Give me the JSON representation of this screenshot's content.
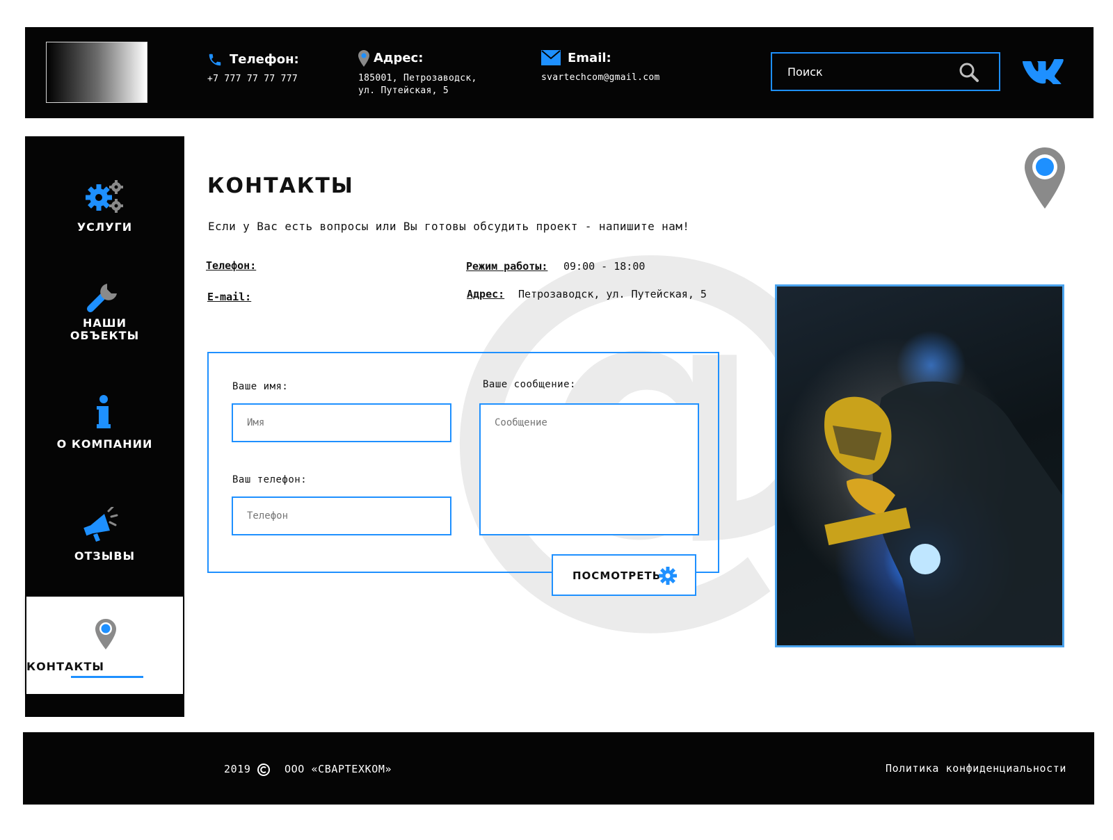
{
  "header": {
    "phone": {
      "label": "Телефон:",
      "value": "+7 777 77 77 777"
    },
    "address": {
      "label": "Адрес:",
      "line1": "185001, Петрозаводск,",
      "line2": "ул. Путейская, 5"
    },
    "email": {
      "label": "Email:",
      "value": "svartechcom@gmail.com"
    },
    "search_placeholder": "Поиск"
  },
  "sidebar": {
    "items": [
      {
        "label": "УСЛУГИ"
      },
      {
        "label_line1": "НАШИ",
        "label_line2": "ОБЪЕКТЫ"
      },
      {
        "label": "О КОМПАНИИ"
      },
      {
        "label": "ОТЗЫВЫ"
      },
      {
        "label": "КОНТАКТЫ"
      }
    ]
  },
  "main": {
    "title": "КОНТАКТЫ",
    "intro": "Если у Вас есть вопросы или Вы готовы обсудить проект - напишите нам!",
    "info": {
      "phone_label": "Телефон:",
      "email_label": "E-mail:",
      "hours_label": "Режим работы:",
      "hours_value": "09:00 - 18:00",
      "address_label": "Адрес:",
      "address_value": "Петрозаводск, ул. Путейская, 5"
    },
    "form": {
      "name_label": "Ваше имя:",
      "name_placeholder": "Имя",
      "phone_label": "Ваш телефон:",
      "phone_placeholder": "Телефон",
      "message_label": "Ваше сообщение:",
      "message_placeholder": "Сообщение",
      "submit_label": "ПОСМОТРЕТЬ"
    },
    "background_glyph": "@"
  },
  "footer": {
    "year": "2019",
    "company": "ООО «СВАРТЕХКОМ»",
    "privacy": "Политика конфиденциальности"
  },
  "colors": {
    "accent": "#1e90ff",
    "dark": "#050505",
    "icon_gray": "#8a8a8a"
  }
}
